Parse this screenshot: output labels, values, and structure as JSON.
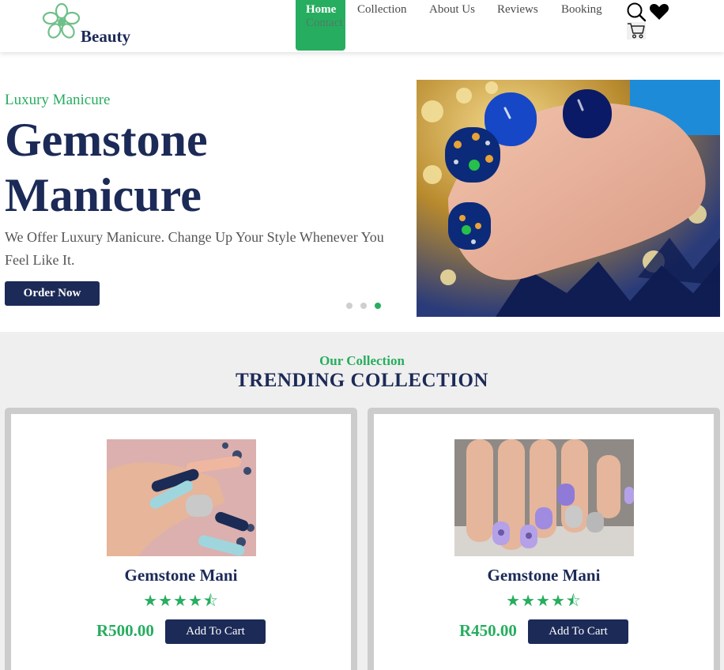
{
  "brand": {
    "name": "Beauty",
    "logo_icon": "flower-icon",
    "accent": "#27ad5f",
    "navy": "#1c2a57"
  },
  "nav": {
    "home": "Home",
    "contact": "Contact",
    "collection": "Collection",
    "about": "About Us",
    "reviews": "Reviews",
    "booking": "Booking"
  },
  "header_icons": [
    "search-icon",
    "heart-icon",
    "cart-icon"
  ],
  "hero": {
    "kicker": "Luxury Manicure",
    "title_line1": "Gemstone",
    "title_line2": "Manicure",
    "description": "We Offer Luxury Manicure. Change Up Your Style Whenever You Feel Like It.",
    "cta": "Order Now",
    "slides_total": 3,
    "active_slide": 3
  },
  "collection": {
    "kicker": "Our Collection",
    "title": "TRENDING COLLECTION",
    "products": [
      {
        "name": "Gemstone Mani",
        "rating": 4.5,
        "stars": "★★★★⯪",
        "price": "R500.00",
        "button": "Add To Cart"
      },
      {
        "name": "Gemstone Mani",
        "rating": 4.5,
        "stars": "★★★★⯪",
        "price": "R450.00",
        "button": "Add To Cart"
      }
    ]
  }
}
